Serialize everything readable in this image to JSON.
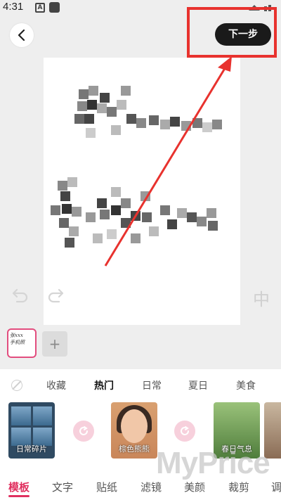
{
  "status_bar": {
    "time": "4:31",
    "notification_icon_letter": "A"
  },
  "header": {
    "next_label": "下一步"
  },
  "thumbnail": {
    "text_line1": "张xxx",
    "text_line2": "手机照"
  },
  "categories": [
    "收藏",
    "热门",
    "日常",
    "夏日",
    "美食"
  ],
  "active_category": "热门",
  "templates": [
    {
      "label": "日常碎片",
      "icon": "collage-thumbnail"
    },
    {
      "label": "棕色熊熊",
      "icon": "portrait-thumbnail"
    },
    {
      "label": "春日气息",
      "icon": "nature-thumbnail"
    }
  ],
  "tabs": [
    "模板",
    "文字",
    "贴纸",
    "滤镜",
    "美颜",
    "裁剪",
    "调"
  ],
  "active_tab": "模板",
  "watermark": "MyPrice",
  "colors": {
    "accent": "#e0305f",
    "highlight": "#e8322e",
    "button_dark": "#1a1a1a"
  }
}
